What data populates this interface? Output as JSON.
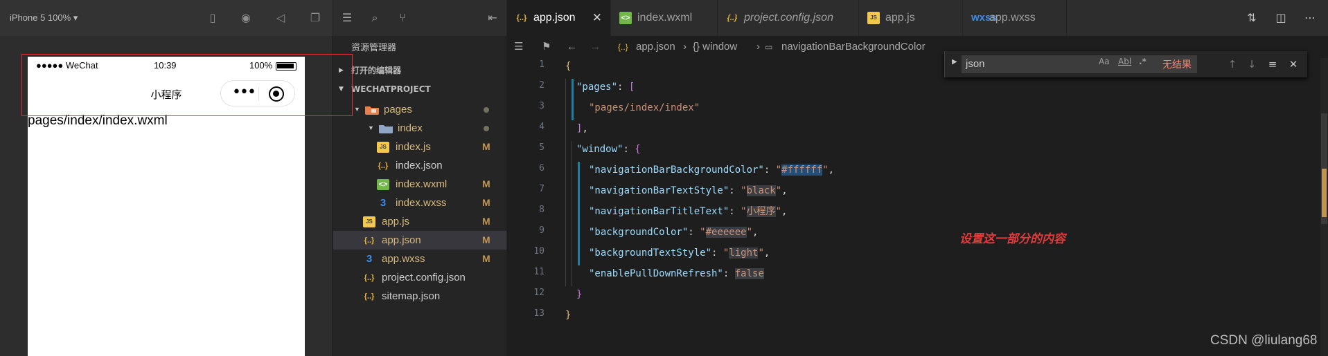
{
  "simulator": {
    "device_label": "iPhone 5 100% ▾",
    "status": {
      "carrier": "●●●●● WeChat",
      "time": "10:39",
      "battery": "100%"
    },
    "nav_title": "小程序",
    "page_path": "pages/index/index.wxml"
  },
  "explorer": {
    "title": "资源管理器",
    "open_editors": "打开的编辑器",
    "project": "WECHATPROJECT",
    "tree": [
      {
        "name": "pages",
        "mark": ""
      },
      {
        "name": "index",
        "mark": ""
      },
      {
        "name": "index.js",
        "mark": "M"
      },
      {
        "name": "index.json",
        "mark": ""
      },
      {
        "name": "index.wxml",
        "mark": "M"
      },
      {
        "name": "index.wxss",
        "mark": "M"
      },
      {
        "name": "app.js",
        "mark": "M"
      },
      {
        "name": "app.json",
        "mark": "M"
      },
      {
        "name": "app.wxss",
        "mark": "M"
      },
      {
        "name": "project.config.json",
        "mark": ""
      },
      {
        "name": "sitemap.json",
        "mark": ""
      }
    ]
  },
  "editor": {
    "tabs": [
      {
        "label": "app.json",
        "icon": "{..}"
      },
      {
        "label": "index.wxml",
        "icon": "<>"
      },
      {
        "label": "project.config.json",
        "icon": "{..}"
      },
      {
        "label": "app.js",
        "icon": "JS"
      },
      {
        "label": "app.wxss",
        "icon": "wxss"
      }
    ],
    "breadcrumb": {
      "file": "app.json",
      "sep": "›",
      "obj": "{} window",
      "prop": "navigationBarBackgroundColor"
    },
    "line_numbers": [
      "1",
      "2",
      "3",
      "4",
      "5",
      "6",
      "7",
      "8",
      "9",
      "10",
      "11",
      "12",
      "13"
    ],
    "code": {
      "l1": "{",
      "l2_key": "\"pages\"",
      "l2_rest": ": [",
      "l3": "\"pages/index/index\"",
      "l4": "],",
      "l5_key": "\"window\"",
      "l5_rest": ": {",
      "l6_key": "\"navigationBarBackgroundColor\"",
      "l6_val": "#ffffff",
      "l7_key": "\"navigationBarTextStyle\"",
      "l7_val": "black",
      "l8_key": "\"navigationBarTitleText\"",
      "l8_val": "小程序",
      "l9_key": "\"backgroundColor\"",
      "l9_val": "#eeeeee",
      "l10_key": "\"backgroundTextStyle\"",
      "l10_val": "light",
      "l11_key": "\"enablePullDownRefresh\"",
      "l11_val": "false",
      "l12": "}",
      "l13": "}",
      "colon": ": ",
      "q": "\"",
      "comma": ","
    },
    "find": {
      "query": "json",
      "case": "Aa",
      "word": "Abl",
      "regex": ".*",
      "result": "无结果"
    },
    "annotation": "设置这一部分的内容"
  },
  "watermark": "CSDN @liulang68",
  "colors": {
    "accent_red": "#e0333b",
    "folder": "#e8804a",
    "selection": "#264f78"
  }
}
